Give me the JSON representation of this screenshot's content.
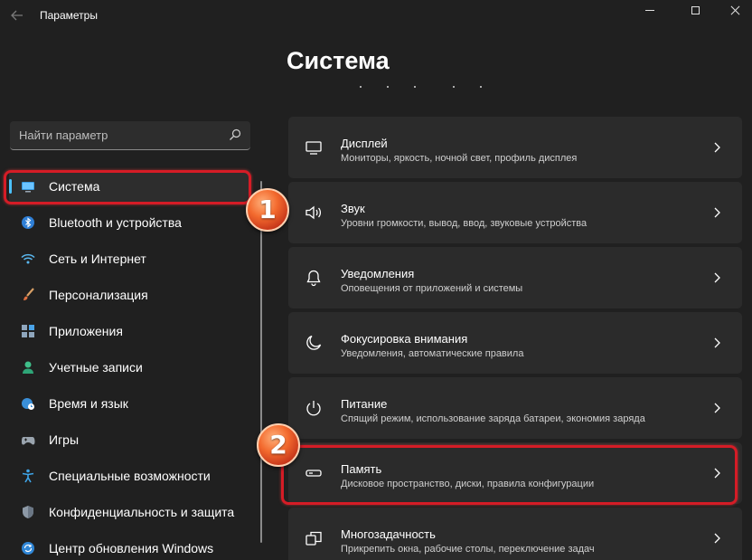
{
  "window": {
    "title": "Параметры"
  },
  "page": {
    "title": "Система"
  },
  "search": {
    "placeholder": "Найти параметр"
  },
  "accent": "#4cc2ff",
  "highlight_color": "#d51c26",
  "sidebar": {
    "items": [
      {
        "label": "Система",
        "icon": "system-monitor-icon",
        "active": true
      },
      {
        "label": "Bluetooth и устройства",
        "icon": "bluetooth-icon"
      },
      {
        "label": "Сеть и Интернет",
        "icon": "wifi-icon"
      },
      {
        "label": "Персонализация",
        "icon": "brush-icon"
      },
      {
        "label": "Приложения",
        "icon": "apps-icon"
      },
      {
        "label": "Учетные записи",
        "icon": "person-icon"
      },
      {
        "label": "Время и язык",
        "icon": "globe-clock-icon"
      },
      {
        "label": "Игры",
        "icon": "gamepad-icon"
      },
      {
        "label": "Специальные возможности",
        "icon": "accessibility-icon"
      },
      {
        "label": "Конфиденциальность и защита",
        "icon": "shield-icon"
      },
      {
        "label": "Центр обновления Windows",
        "icon": "update-icon"
      }
    ]
  },
  "settings": {
    "cards": [
      {
        "title": "Дисплей",
        "desc": "Мониторы, яркость, ночной свет, профиль дисплея",
        "icon": "display-icon"
      },
      {
        "title": "Звук",
        "desc": "Уровни громкости, вывод, ввод, звуковые устройства",
        "icon": "speaker-icon"
      },
      {
        "title": "Уведомления",
        "desc": "Оповещения от приложений и системы",
        "icon": "bell-icon"
      },
      {
        "title": "Фокусировка внимания",
        "desc": "Уведомления, автоматические правила",
        "icon": "moon-icon"
      },
      {
        "title": "Питание",
        "desc": "Спящий режим, использование заряда батареи, экономия заряда",
        "icon": "power-icon"
      },
      {
        "title": "Память",
        "desc": "Дисковое пространство, диски, правила конфигурации",
        "icon": "storage-icon"
      },
      {
        "title": "Многозадачность",
        "desc": "Прикрепить окна, рабочие столы, переключение задач",
        "icon": "multitasking-icon"
      }
    ]
  },
  "annotations": {
    "badge1": "1",
    "badge2": "2"
  }
}
